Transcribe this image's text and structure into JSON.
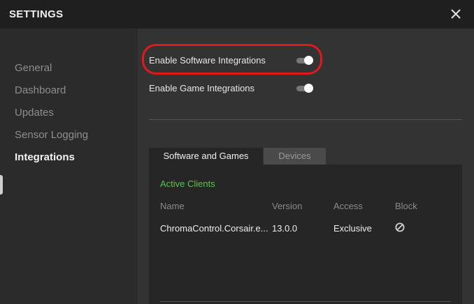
{
  "window": {
    "title": "SETTINGS"
  },
  "sidebar": {
    "items": [
      {
        "label": "General"
      },
      {
        "label": "Dashboard"
      },
      {
        "label": "Updates"
      },
      {
        "label": "Sensor Logging"
      },
      {
        "label": "Integrations",
        "active": true
      }
    ]
  },
  "toggles": {
    "software": {
      "label": "Enable Software Integrations",
      "on": true
    },
    "game": {
      "label": "Enable Game Integrations",
      "on": true
    }
  },
  "tabs": [
    {
      "label": "Software and Games",
      "selected": true
    },
    {
      "label": "Devices",
      "selected": false
    }
  ],
  "clients": {
    "heading": "Active Clients",
    "columns": [
      "Name",
      "Version",
      "Access",
      "Block"
    ],
    "rows": [
      {
        "name": "ChromaControl.Corsair.e...",
        "version": "13.0.0",
        "access": "Exclusive",
        "block_icon": "block-icon"
      }
    ]
  },
  "colors": {
    "accent_green": "#50c850",
    "annotation_red": "#e0191c"
  }
}
